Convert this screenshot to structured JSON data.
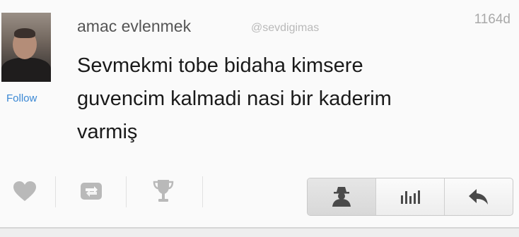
{
  "tweet": {
    "display_name": "amac evlenmek",
    "handle": "@sevdigimas",
    "time": "1164d",
    "follow_label": "Follow",
    "text_lines": [
      "Sevmekmi tobe bidaha kimsere",
      "guvencim kalmadi nasi bir kaderim",
      "varmiş"
    ]
  },
  "actions": {
    "icons": [
      "heart-icon",
      "retweet-icon",
      "trophy-icon"
    ]
  },
  "segmented": {
    "icons": [
      "profile-icon",
      "stats-icon",
      "reply-icon"
    ],
    "active_index": 0
  },
  "colors": {
    "follow": "#3b88d4",
    "icon_gray": "#b9b9b9",
    "icon_dark": "#4a4a4a"
  }
}
